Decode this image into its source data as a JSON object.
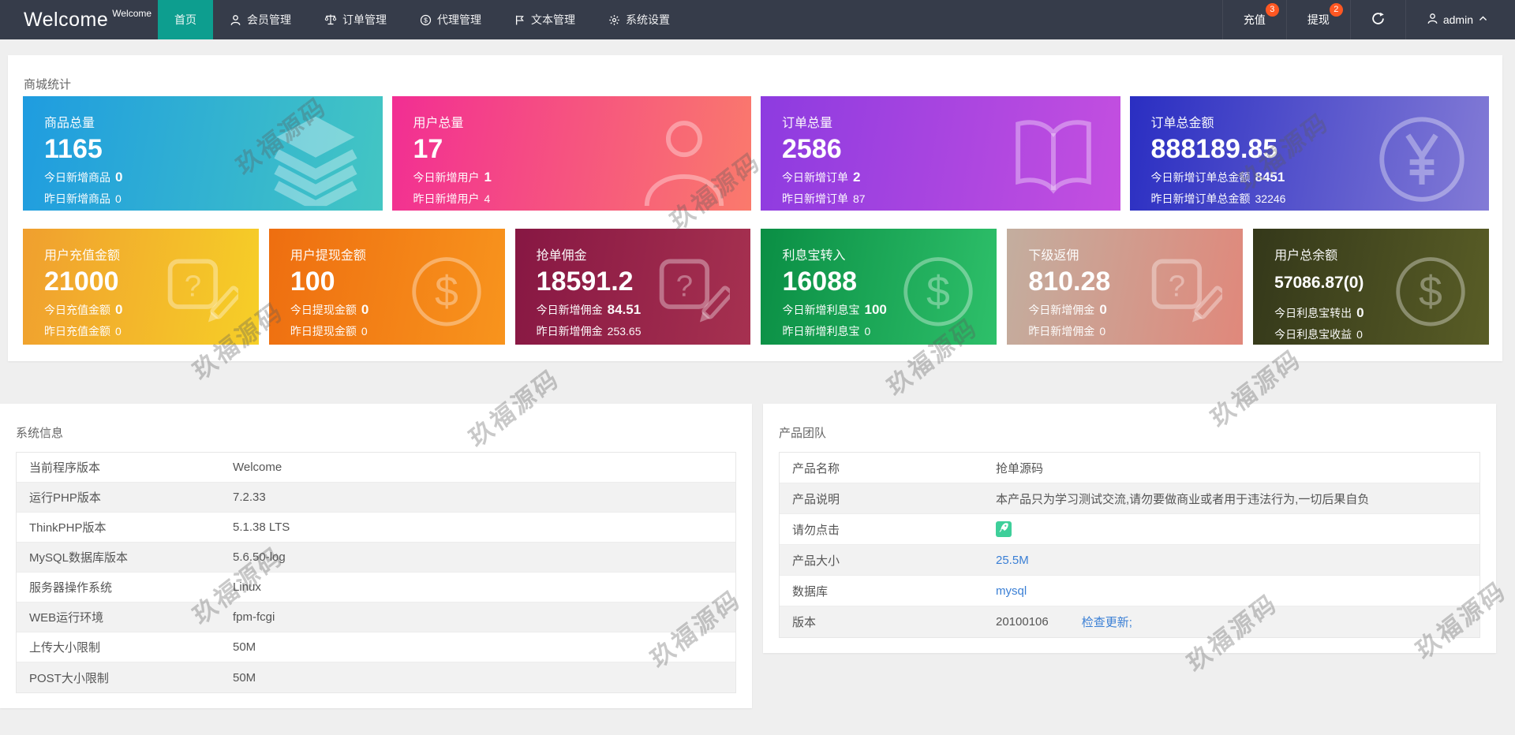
{
  "nav": {
    "logo": "Welcome",
    "logo_sup": "Welcome",
    "items": [
      {
        "label": "首页",
        "icon": null,
        "active": true,
        "key": "home"
      },
      {
        "label": "会员管理",
        "icon": "user",
        "active": false,
        "key": "members"
      },
      {
        "label": "订单管理",
        "icon": "scales",
        "active": false,
        "key": "orders"
      },
      {
        "label": "代理管理",
        "icon": "dollar-circle",
        "active": false,
        "key": "agents"
      },
      {
        "label": "文本管理",
        "icon": "flag",
        "active": false,
        "key": "text"
      },
      {
        "label": "系统设置",
        "icon": "gear",
        "active": false,
        "key": "settings"
      }
    ],
    "right": {
      "recharge": "充值",
      "recharge_badge": "3",
      "withdraw": "提现",
      "withdraw_badge": "2",
      "user": "admin"
    }
  },
  "stats": {
    "heading": "商城统计",
    "cards_row1": [
      {
        "title": "商品总量",
        "value": "1165",
        "icon": "layers",
        "gradient": [
          "#1f9ce0",
          "#43c6c3"
        ],
        "lines": [
          [
            "今日新增商品",
            "0"
          ],
          [
            "昨日新增商品",
            "0"
          ]
        ]
      },
      {
        "title": "用户总量",
        "value": "17",
        "icon": "person",
        "gradient": [
          "#f22e93",
          "#fa7a6c"
        ],
        "lines": [
          [
            "今日新增用户",
            "1"
          ],
          [
            "昨日新增用户",
            "4"
          ]
        ]
      },
      {
        "title": "订单总量",
        "value": "2586",
        "icon": "book",
        "gradient": [
          "#8d3be0",
          "#c44fe0"
        ],
        "lines": [
          [
            "今日新增订单",
            "2"
          ],
          [
            "昨日新增订单",
            "87"
          ]
        ]
      },
      {
        "title": "订单总金额",
        "value": "888189.85",
        "icon": "yen-circle",
        "gradient": [
          "#2a2ec2",
          "#837bd6"
        ],
        "lines": [
          [
            "今日新增订单总金额",
            "8451"
          ],
          [
            "昨日新增订单总金额",
            "32246"
          ]
        ]
      }
    ],
    "cards_row2": [
      {
        "title": "用户充值金额",
        "value": "21000",
        "icon": "help-edit",
        "gradient": [
          "#f09f2f",
          "#f6cf27"
        ],
        "lines": [
          [
            "今日充值金额",
            "0"
          ],
          [
            "昨日充值金额",
            "0"
          ]
        ]
      },
      {
        "title": "用户提现金额",
        "value": "100",
        "icon": "dollar-circle",
        "gradient": [
          "#ee6e10",
          "#f8941d"
        ],
        "lines": [
          [
            "今日提现金额",
            "0"
          ],
          [
            "昨日提现金额",
            "0"
          ]
        ]
      },
      {
        "title": "抢单佣金",
        "value": "18591.2",
        "icon": "help-edit",
        "gradient": [
          "#871743",
          "#a63150"
        ],
        "lines": [
          [
            "今日新增佣金",
            "84.51"
          ],
          [
            "昨日新增佣金",
            "253.65"
          ]
        ]
      },
      {
        "title": "利息宝转入",
        "value": "16088",
        "icon": "dollar-circle",
        "gradient": [
          "#0a8e44",
          "#2ec06a"
        ],
        "lines": [
          [
            "今日新增利息宝",
            "100"
          ],
          [
            "昨日新增利息宝",
            "0"
          ]
        ]
      },
      {
        "title": "下级返佣",
        "value": "810.28",
        "icon": "help-edit",
        "gradient": [
          "#c3ae9f",
          "#e0887b"
        ],
        "lines": [
          [
            "今日新增佣金",
            "0"
          ],
          [
            "昨日新增佣金",
            "0"
          ]
        ]
      },
      {
        "title": "用户总余额",
        "value": "57086.87(0)",
        "small": true,
        "icon": "dollar-circle",
        "gradient": [
          "#34381a",
          "#595d26"
        ],
        "lines": [
          [
            "今日利息宝转出",
            "0"
          ],
          [
            "今日利息宝收益",
            "0"
          ]
        ]
      }
    ]
  },
  "system_info": {
    "heading": "系统信息",
    "rows": [
      [
        "当前程序版本",
        "Welcome"
      ],
      [
        "运行PHP版本",
        "7.2.33"
      ],
      [
        "ThinkPHP版本",
        "5.1.38 LTS"
      ],
      [
        "MySQL数据库版本",
        "5.6.50-log"
      ],
      [
        "服务器操作系统",
        "Linux"
      ],
      [
        "WEB运行环境",
        "fpm-fcgi"
      ],
      [
        "上传大小限制",
        "50M"
      ],
      [
        "POST大小限制",
        "50M"
      ]
    ]
  },
  "product_team": {
    "heading": "产品团队",
    "rows": [
      {
        "label": "产品名称",
        "type": "text",
        "value": "抢单源码"
      },
      {
        "label": "产品说明",
        "type": "text",
        "value": "本产品只为学习测试交流,请勿要做商业或者用于违法行为,一切后果自负"
      },
      {
        "label": "请勿点击",
        "type": "icon",
        "value": ""
      },
      {
        "label": "产品大小",
        "type": "link",
        "value": "25.5M"
      },
      {
        "label": "数据库",
        "type": "link",
        "value": "mysql"
      },
      {
        "label": "版本",
        "type": "text-link",
        "value": "20100106",
        "link": "检查更新;"
      }
    ]
  },
  "watermark": {
    "text": "玖福源码"
  },
  "colors": {
    "navbar": "#363c4a",
    "active_tab": "#0d9e8f",
    "badge": "#ff5722",
    "link": "#3a7fd5",
    "rocket_icon_bg": "#3ecf9a"
  }
}
